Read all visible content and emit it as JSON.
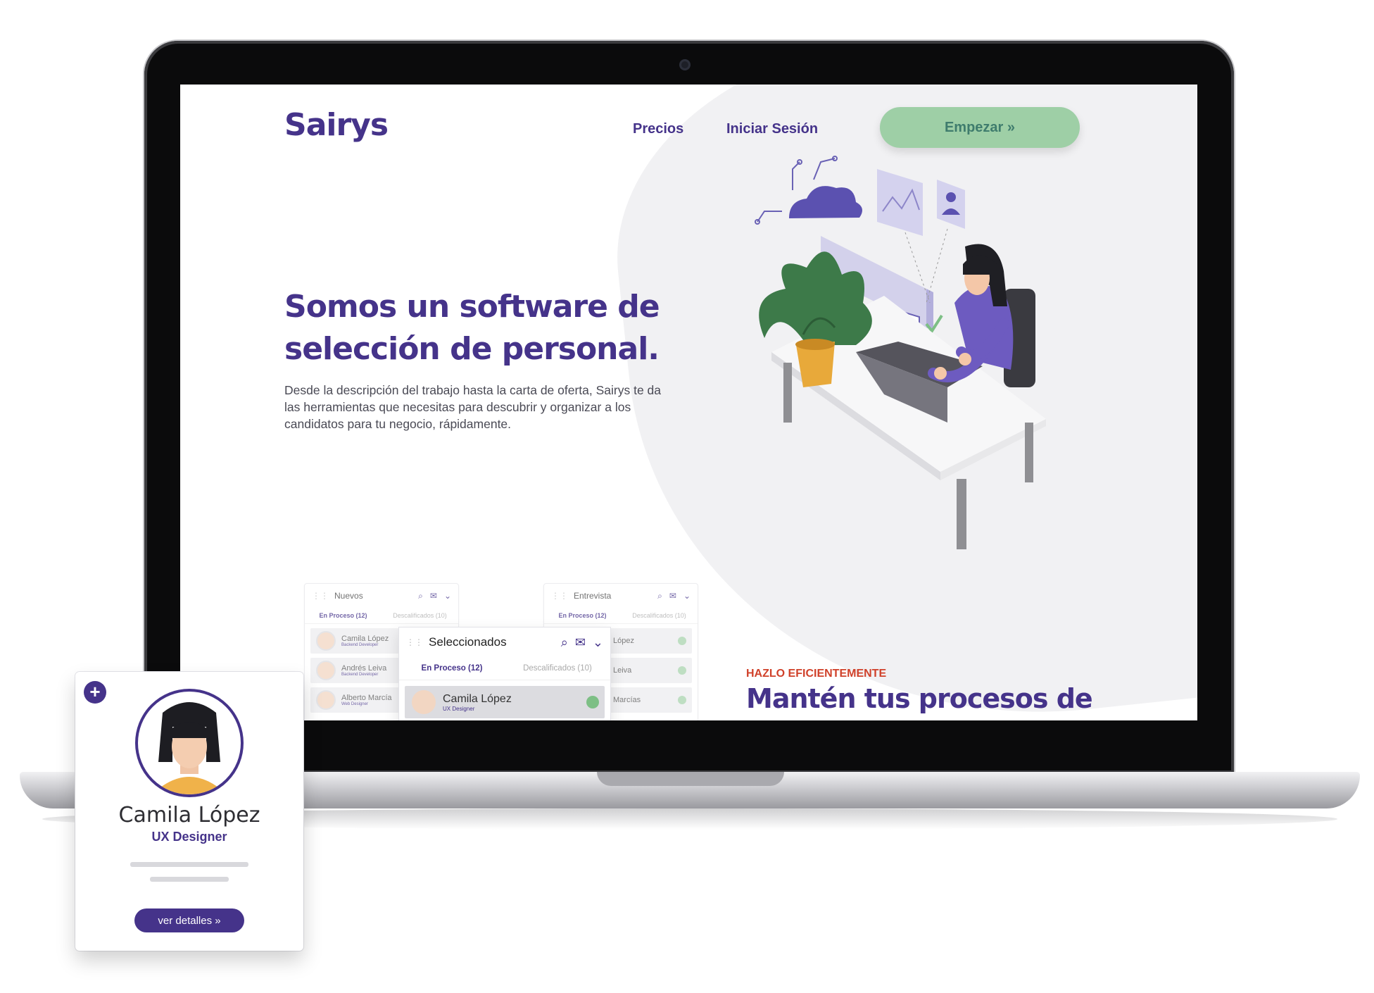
{
  "header": {
    "logo": "Sairys",
    "nav": [
      "Precios",
      "Iniciar Sesión"
    ],
    "cta": "Empezar »"
  },
  "hero": {
    "title_line1": "Somos un software de",
    "title_line2": "selección de personal.",
    "description": "Desde la descripción del trabajo hasta la carta de oferta, Sairys te da las herramientas que necesitas para descubrir y organizar a los candidatos para tu negocio, rápidamente."
  },
  "section": {
    "eyebrow": "HAZLO EFICIENTEMENTE",
    "title": "Mantén tus procesos de"
  },
  "kanban": {
    "nuevos": {
      "title": "Nuevos",
      "tab_active": "En Proceso (12)",
      "tab_inactive": "Descalificados (10)",
      "items": [
        {
          "name": "Camila López",
          "role": "Backend Developer"
        },
        {
          "name": "Andrés Leiva",
          "role": "Backend Developer"
        },
        {
          "name": "Alberto Marcía",
          "role": "Web Designer"
        }
      ]
    },
    "entrevista": {
      "title": "Entrevista",
      "tab_active": "En Proceso (12)",
      "tab_inactive": "Descalificados (10)",
      "items": [
        {
          "name": "López"
        },
        {
          "name": "Leiva"
        },
        {
          "name": "Marcías"
        }
      ]
    },
    "seleccionados": {
      "title": "Seleccionados",
      "tab_active": "En Proceso (12)",
      "tab_inactive": "Descalificados (10)",
      "item": {
        "name": "Camila López",
        "role": "UX Designer"
      }
    }
  },
  "profile_card": {
    "name": "Camila López",
    "role": "UX Designer",
    "button": "ver detalles »"
  },
  "colors": {
    "brand_purple": "#45338a",
    "cta_green": "#9ecfa6",
    "eyebrow_red": "#d0412a"
  }
}
